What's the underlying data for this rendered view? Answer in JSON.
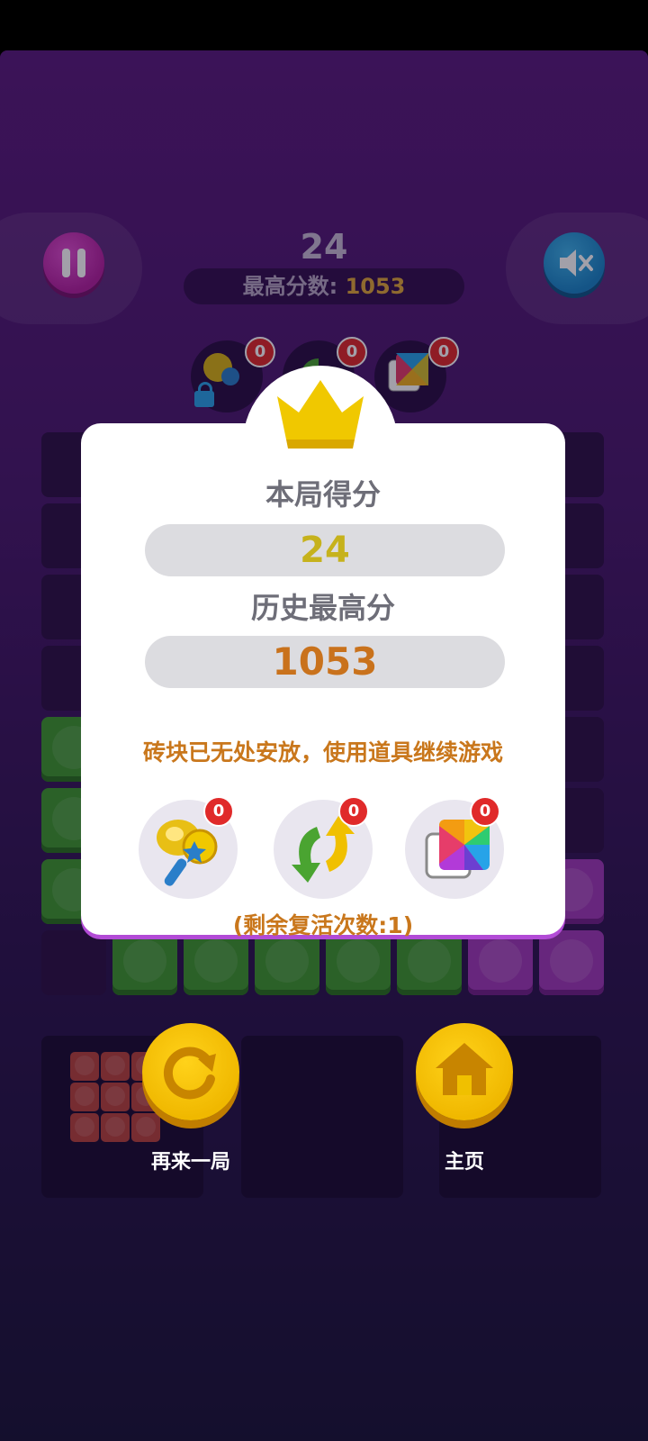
{
  "hud": {
    "current_score": "24",
    "best_label": "最高分数: ",
    "best_value": "1053",
    "top_tool_counts": [
      "0",
      "0",
      "0"
    ]
  },
  "dialog": {
    "round_score_title": "本局得分",
    "round_score": "24",
    "history_best_title": "历史最高分",
    "history_best": "1053",
    "message": "砖块已无处安放，使用道具继续游戏",
    "powerups": [
      {
        "icon": "hammer-icon",
        "count": "0"
      },
      {
        "icon": "refresh-arrows-icon",
        "count": "0"
      },
      {
        "icon": "rainbow-block-icon",
        "count": "0"
      }
    ],
    "revive_text": "(剩余复活次数:1)"
  },
  "buttons": {
    "restart_label": "再来一局",
    "home_label": "主页"
  },
  "colors": {
    "round_score": "#c6b21c",
    "history_best": "#c9721c",
    "accent_gold": "#f0b800"
  }
}
